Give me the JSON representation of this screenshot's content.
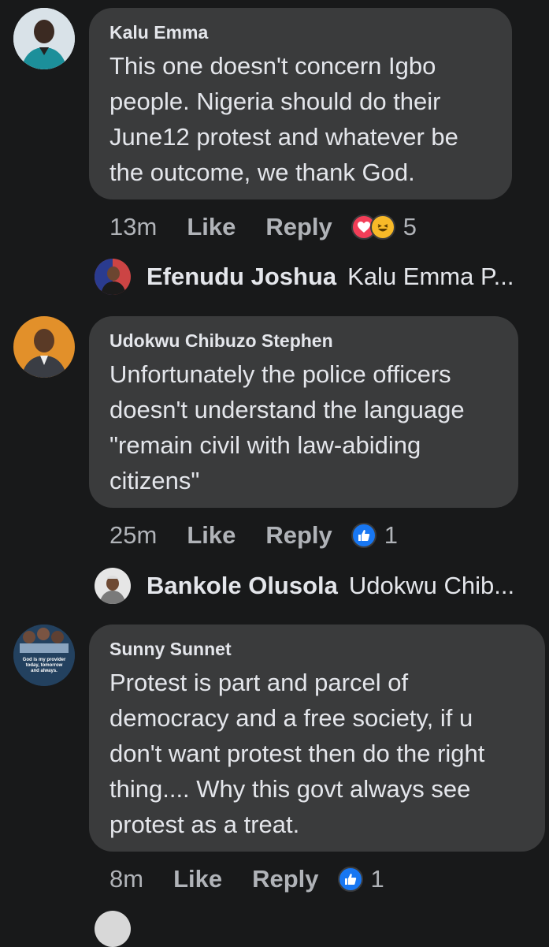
{
  "comments": [
    {
      "author": "Kalu Emma",
      "lines": [
        "This one doesn't concern Igbo",
        "people. Nigeria should do their",
        "June12 protest and whatever be",
        "the outcome, we thank God."
      ],
      "time": "13m",
      "like": "Like",
      "reply": "Reply",
      "reaction_count": "5",
      "reactions": [
        "love-icon",
        "haha-icon"
      ],
      "reply_preview": {
        "name": "Efenudu Joshua",
        "text": "Kalu Emma P..."
      }
    },
    {
      "author": "Udokwu Chibuzo Stephen",
      "lines": [
        "Unfortunately the police officers",
        "doesn't understand the language",
        "\"remain civil with law-abiding",
        "citizens\""
      ],
      "time": "25m",
      "like": "Like",
      "reply": "Reply",
      "reaction_count": "1",
      "reactions": [
        "like-icon"
      ],
      "reply_preview": {
        "name": "Bankole Olusola",
        "text": "Udokwu Chib..."
      }
    },
    {
      "author": "Sunny Sunnet",
      "avatar_text": "God is my provider today, tomorrow and always.",
      "lines": [
        "Protest is part and parcel of",
        "democracy and a free society, if u",
        "don't want protest then do the right",
        "thing.... Why this govt always see",
        "protest as a treat."
      ],
      "time": "8m",
      "like": "Like",
      "reply": "Reply",
      "reaction_count": "1",
      "reactions": [
        "like-icon"
      ]
    }
  ],
  "colors": {
    "background": "#18191a",
    "bubble": "#3a3b3c",
    "text": "#e4e6eb",
    "muted": "#b0b3b8",
    "like_blue": "#1877f2",
    "love_red": "#f33e58",
    "haha_yellow": "#f7b928"
  }
}
